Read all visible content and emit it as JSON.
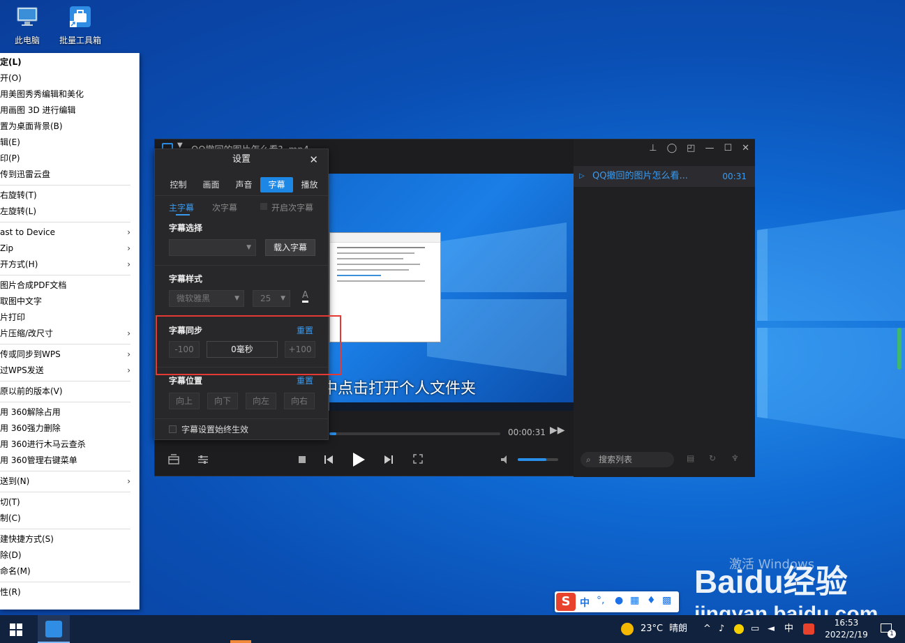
{
  "desktop": {
    "icons": [
      {
        "label": "此电脑"
      },
      {
        "label": "批量工具箱"
      }
    ],
    "activation_watermark": "激活 Windows",
    "baidu_logo": "Baidu经验",
    "baidu_url": "jingyan.baidu.com"
  },
  "context_menu": {
    "items": [
      {
        "label": "定(L)"
      },
      {
        "label": "开(O)"
      },
      {
        "label": "用美图秀秀编辑和美化"
      },
      {
        "label": "用画图 3D 进行编辑"
      },
      {
        "label": "置为桌面背景(B)"
      },
      {
        "label": "辑(E)"
      },
      {
        "label": "印(P)"
      },
      {
        "label": "传到迅雷云盘"
      },
      {
        "label": "右旋转(T)"
      },
      {
        "label": "左旋转(L)"
      },
      {
        "label": "ast to Device"
      },
      {
        "label": "Zip"
      },
      {
        "label": "开方式(H)"
      },
      {
        "label": "图片合成PDF文档"
      },
      {
        "label": "取图中文字"
      },
      {
        "label": "片打印"
      },
      {
        "label": "片压缩/改尺寸"
      },
      {
        "label": "传或同步到WPS"
      },
      {
        "label": "过WPS发送"
      },
      {
        "label": "原以前的版本(V)"
      },
      {
        "label": "用 360解除占用"
      },
      {
        "label": "用 360强力删除"
      },
      {
        "label": "用 360进行木马云查杀"
      },
      {
        "label": "用 360管理右键菜单"
      },
      {
        "label": "送到(N)"
      },
      {
        "label": "切(T)"
      },
      {
        "label": "制(C)"
      },
      {
        "label": "建快捷方式(S)"
      },
      {
        "label": "除(D)"
      },
      {
        "label": "命名(M)"
      },
      {
        "label": "性(R)"
      }
    ]
  },
  "player": {
    "title": "QQ撤回的图片怎么看? .mp4",
    "subtitle_line": "中点击打开个人文件夹",
    "time": "00:00:31",
    "playlist": {
      "item_title": "QQ撤回的图片怎么看...",
      "item_duration": "00:31"
    },
    "search_placeholder": "搜索列表",
    "volume_fraction": 0.7
  },
  "settings": {
    "title": "设置",
    "tabs": [
      "控制",
      "画面",
      "声音",
      "字幕",
      "播放"
    ],
    "active_tab": "字幕",
    "subtabs": {
      "main": "主字幕",
      "secondary": "次字幕",
      "enable_secondary": "开启次字幕"
    },
    "subtitle_select": {
      "title": "字幕选择",
      "load_button": "载入字幕"
    },
    "subtitle_style": {
      "title": "字幕样式",
      "font": "微软雅黑",
      "size": "25"
    },
    "subtitle_sync": {
      "title": "字幕同步",
      "reset": "重置",
      "minus": "-100",
      "value": "0毫秒",
      "plus": "+100"
    },
    "subtitle_position": {
      "title": "字幕位置",
      "reset": "重置",
      "buttons": [
        "向上",
        "向下",
        "向左",
        "向右"
      ]
    },
    "always_apply": "字幕设置始终生效"
  },
  "ime": {
    "label": "中"
  },
  "taskbar": {
    "weather_temp": "23°C",
    "weather_text": "晴朗",
    "ime_lang": "中",
    "time": "16:53",
    "date": "2022/2/19",
    "notification_count": "1"
  }
}
